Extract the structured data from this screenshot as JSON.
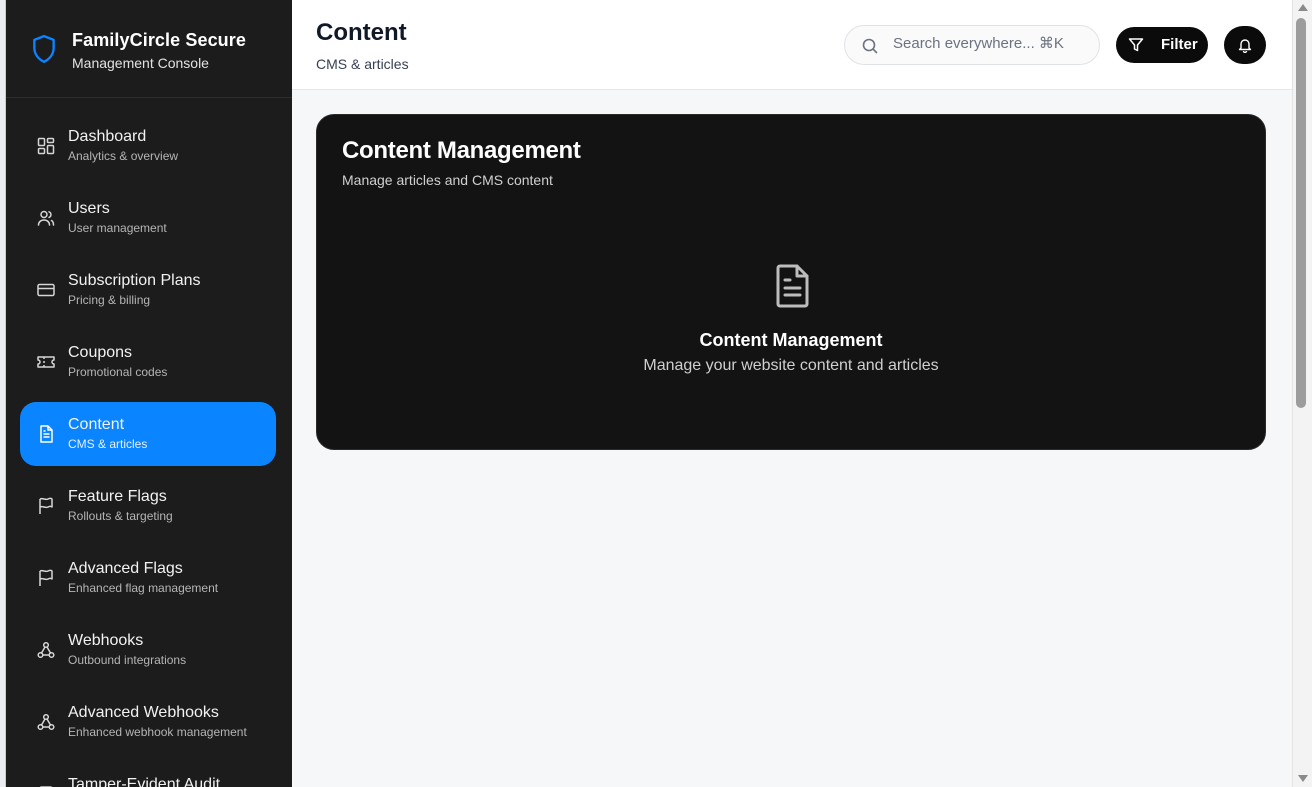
{
  "brand": {
    "title": "FamilyCircle Secure",
    "subtitle": "Management Console",
    "icon": "shield-icon"
  },
  "sidebar": {
    "items": [
      {
        "label": "Dashboard",
        "desc": "Analytics & overview",
        "icon": "grid-icon",
        "active": false
      },
      {
        "label": "Users",
        "desc": "User management",
        "icon": "users-icon",
        "active": false
      },
      {
        "label": "Subscription Plans",
        "desc": "Pricing & billing",
        "icon": "credit-card-icon",
        "active": false
      },
      {
        "label": "Coupons",
        "desc": "Promotional codes",
        "icon": "ticket-icon",
        "active": false
      },
      {
        "label": "Content",
        "desc": "CMS & articles",
        "icon": "file-text-icon",
        "active": true
      },
      {
        "label": "Feature Flags",
        "desc": "Rollouts & targeting",
        "icon": "flag-icon",
        "active": false
      },
      {
        "label": "Advanced Flags",
        "desc": "Enhanced flag management",
        "icon": "flag-icon",
        "active": false
      },
      {
        "label": "Webhooks",
        "desc": "Outbound integrations",
        "icon": "webhook-icon",
        "active": false
      },
      {
        "label": "Advanced Webhooks",
        "desc": "Enhanced webhook management",
        "icon": "webhook-icon",
        "active": false
      },
      {
        "label": "Tamper-Evident Audit",
        "desc": "",
        "icon": "audit-icon",
        "active": false
      }
    ]
  },
  "header": {
    "title": "Content",
    "subtitle": "CMS & articles",
    "search_placeholder": "Search everywhere... ⌘K",
    "filter_label": "Filter"
  },
  "card": {
    "title": "Content Management",
    "subtitle": "Manage articles and CMS content",
    "empty_title": "Content Management",
    "empty_subtitle": "Manage your website content and articles",
    "icon": "file-text-icon"
  },
  "colors": {
    "sidebar_bg": "#1c1c1c",
    "accent": "#0a84ff",
    "card_bg": "#131313",
    "page_bg": "#f6f7f9"
  }
}
